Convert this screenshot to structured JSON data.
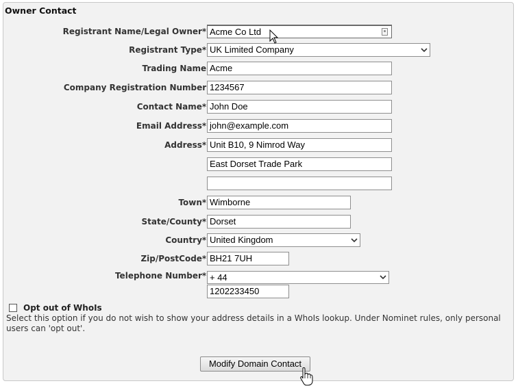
{
  "section_title": "Owner Contact",
  "fields": {
    "registrant_name": {
      "label": "Registrant Name/Legal Owner*:",
      "value": "Acme Co Ltd"
    },
    "registrant_type": {
      "label": "Registrant Type*:",
      "value": "UK Limited Company"
    },
    "trading_name": {
      "label": "Trading Name:",
      "value": "Acme"
    },
    "company_reg": {
      "label": "Company Registration Number:",
      "value": "1234567"
    },
    "contact_name": {
      "label": "Contact Name*:",
      "value": "John Doe"
    },
    "email": {
      "label": "Email Address*:",
      "value": "john@example.com"
    },
    "address": {
      "label": "Address*:",
      "line1": "Unit B10, 9 Nimrod Way",
      "line2": "East Dorset Trade Park",
      "line3": ""
    },
    "town": {
      "label": "Town*:",
      "value": "Wimborne"
    },
    "county": {
      "label": "State/County*:",
      "value": "Dorset"
    },
    "country": {
      "label": "Country*:",
      "value": "United Kingdom"
    },
    "postcode": {
      "label": "Zip/PostCode*:",
      "value": "BH21 7UH"
    },
    "telephone": {
      "label": "Telephone Number*:",
      "code": "+ 44",
      "number": "1202233450"
    }
  },
  "optout": {
    "label": "Opt out of WhoIs",
    "checked": false,
    "help": "Select this option if you do not wish to show your address details in a WhoIs lookup. Under Nominet rules, only personal users can 'opt out'."
  },
  "submit_label": "Modify Domain Contact"
}
